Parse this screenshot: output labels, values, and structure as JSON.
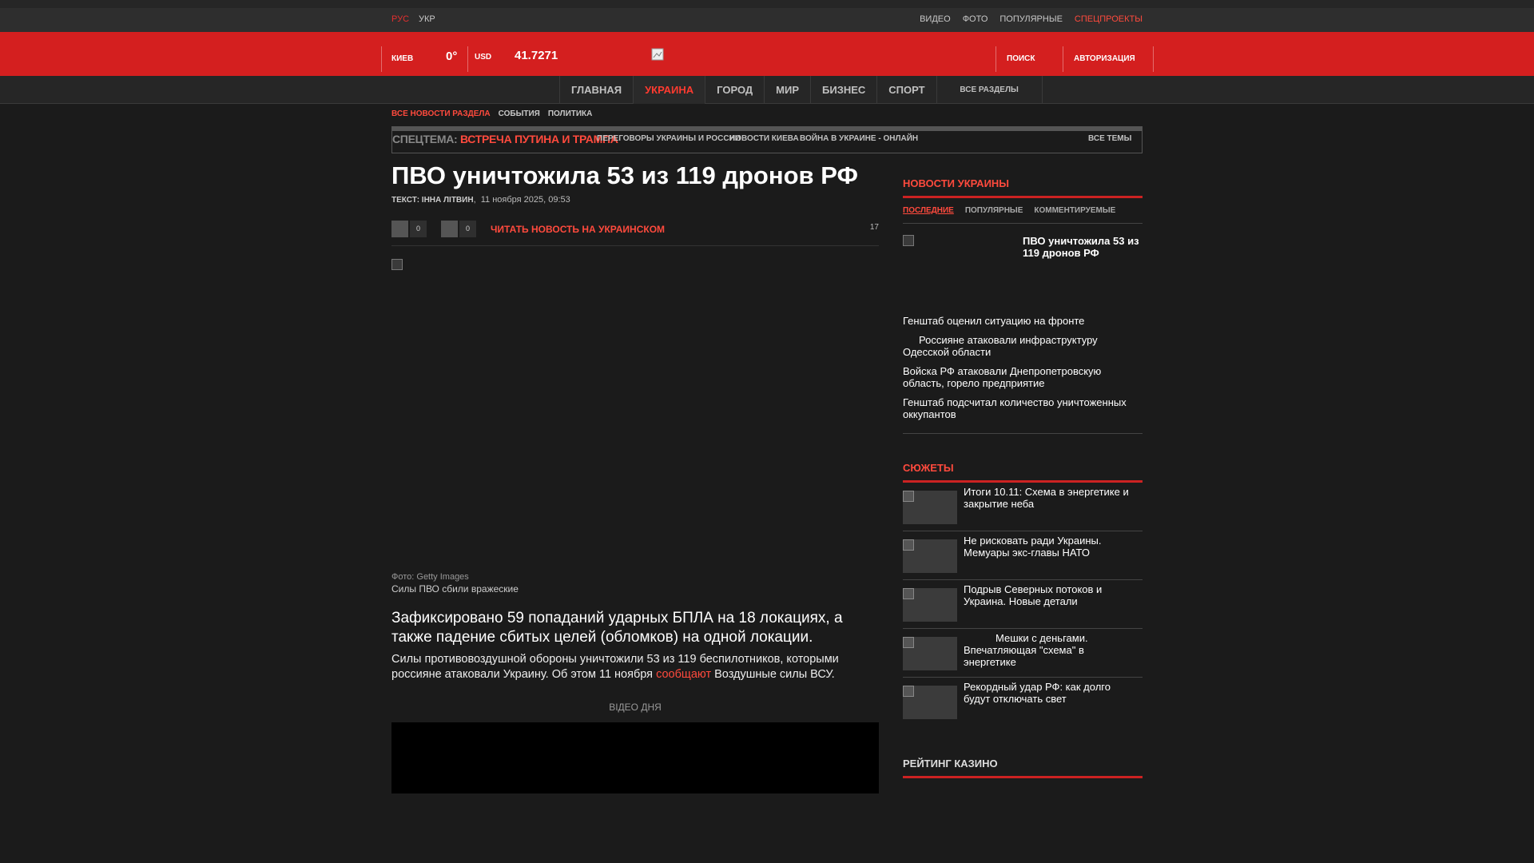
{
  "top": {
    "languages": [
      "РУС",
      "УКР"
    ],
    "links": [
      "ВИДЕО",
      "ФОТО",
      "ПОПУЛЯРНЫЕ",
      "СПЕЦПРОЕКТЫ"
    ]
  },
  "header": {
    "city": "КИЕВ",
    "temperature": "0°",
    "currency_label": "USD",
    "currency_value": "41.7271",
    "search": "ПОИСК",
    "auth": "АВТОРИЗАЦИЯ"
  },
  "nav": {
    "items": [
      "ГЛАВНАЯ",
      "УКРАИНА",
      "ГОРОД",
      "МИР",
      "БИЗНЕС",
      "СПОРТ"
    ],
    "all_sections": "ВСЕ РАЗДЕЛЫ"
  },
  "subnav": [
    "ВСЕ НОВОСТИ РАЗДЕЛА",
    "СОБЫТИЯ",
    "ПОЛИТИКА"
  ],
  "spectheme": {
    "label": "СПЕЦТЕМА:",
    "main": "ВСТРЕЧА ПУТИНА И ТРАМПА",
    "links": [
      "ПЕРЕГОВОРЫ УКРАИНЫ И РОССИИ",
      "НОВОСТИ КИЕВА",
      "ВОЙНА В УКРАИНЕ - ОНЛАЙН"
    ],
    "all": "ВСЕ ТЕМЫ"
  },
  "article": {
    "title": "ПВО уничтожила 53 из 119 дронов РФ",
    "author_label": "ТЕКСТ: ІННА ЛІТВИН",
    "date": "11 ноября 2025, 09:53",
    "share_count_1": "0",
    "share_count_2": "0",
    "read_ukr": "ЧИТАТЬ НОВОСТЬ НА УКРАИНСКОМ",
    "views": "17",
    "photo_credit": "Фото: Getty Images",
    "photo_caption": "Силы ПВО сбили вражеские",
    "lead": "Зафиксировано 59 попаданий ударных БПЛА на 18 локациях, а также падение сбитых целей (обломков) на одной локации.",
    "body_1": "Силы противовоздушной обороны уничтожили 53 из 119 беспилотников, которыми россияне атаковали Украину. Об этом 11 ноября ",
    "body_link": "сообщают",
    "body_2": " Воздушные силы ВСУ.",
    "video_of_day": "ВІДЕО ДНЯ"
  },
  "sidebar": {
    "title": "НОВОСТИ УКРАИНЫ",
    "tabs": [
      "ПОСЛЕДНИЕ",
      "ПОПУЛЯРНЫЕ",
      "КОММЕНТИРУЕМЫЕ"
    ],
    "featured": "ПВО уничтожила 53 из 119 дронов РФ",
    "news": [
      "Генштаб оценил ситуацию на фронте",
      "Россияне атаковали инфраструктуру Одесской области",
      "Войска РФ атаковали Днепропетровскую область, горело предприятие",
      "Генштаб подсчитал количество уничтоженных оккупантов"
    ]
  },
  "stories": {
    "title": "СЮЖЕТЫ",
    "items": [
      "Итоги 10.11: Схема в энергетике и закрытие неба",
      "Не рисковать ради Украины. Мемуары экс-главы НАТО",
      "Подрыв Северных потоков и Украина. Новые детали",
      "Мешки с деньгами. Впечатляющая \"схема\" в энергетике",
      "Рекордный удар РФ: как долго будут отключать свет"
    ]
  },
  "casino": {
    "title": "РЕЙТИНГ КАЗИНО"
  },
  "colors": {
    "brand_red": "#d41f1f",
    "accent": "#ff4a3d",
    "background": "#1b1b1b"
  }
}
